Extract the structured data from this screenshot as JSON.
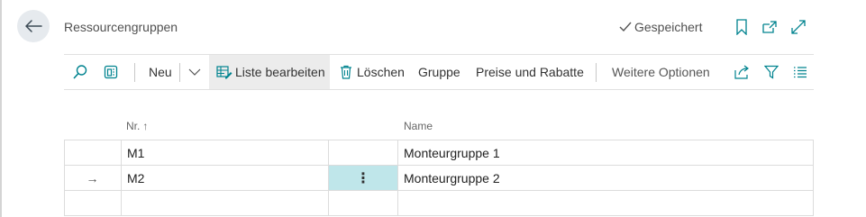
{
  "header": {
    "title": "Ressourcengruppen",
    "saved_status": "Gespeichert",
    "icons": {
      "back": "arrow-left-icon",
      "bookmark": "bookmark-icon",
      "open_new": "open-in-new-window-icon",
      "expand": "expand-icon"
    }
  },
  "actionbar": {
    "new_label": "Neu",
    "edit_list_label": "Liste bearbeiten",
    "delete_label": "Löschen",
    "group_label": "Gruppe",
    "prices_label": "Preise und Rabatte",
    "more_options_label": "Weitere Optionen",
    "icons": [
      "search-icon",
      "details-pane-icon",
      "chevron-down-icon",
      "edit-list-icon",
      "trash-icon",
      "share-icon",
      "filter-icon",
      "list-view-icon"
    ]
  },
  "table": {
    "columns": {
      "nr": "Nr.",
      "nr_sort_indicator": "↑",
      "name": "Name"
    },
    "rows": [
      {
        "nr": "M1",
        "name": "Monteurgruppe 1",
        "selected": false
      },
      {
        "nr": "M2",
        "name": "Monteurgruppe 2",
        "selected": true,
        "row_indicator": "→",
        "menu": "⋮"
      }
    ]
  },
  "colors": {
    "accent": "#00838f",
    "selected_cell": "#bfe6ea",
    "back_button_bg": "#e6eaee"
  }
}
